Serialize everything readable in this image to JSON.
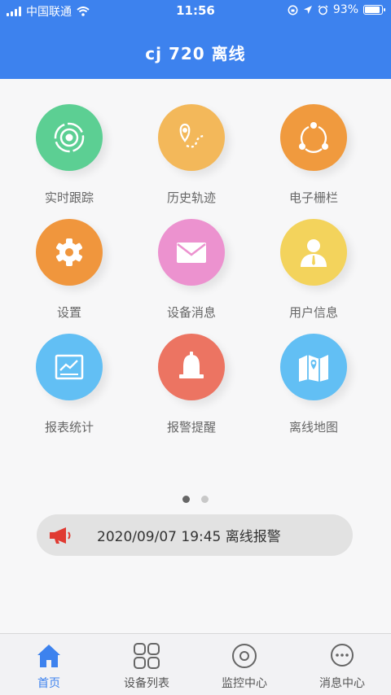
{
  "status_bar": {
    "carrier": "中国联通",
    "time": "11:56",
    "battery": "93%"
  },
  "header": {
    "title": "cj 720 离线"
  },
  "colors": {
    "primary": "#3d82ee"
  },
  "menu": [
    {
      "label": "实时跟踪",
      "icon": "target-icon",
      "color": "#5ccf93"
    },
    {
      "label": "历史轨迹",
      "icon": "route-pin-icon",
      "color": "#f3b85a"
    },
    {
      "label": "电子栅栏",
      "icon": "fence-nodes-icon",
      "color": "#f09a3e"
    },
    {
      "label": "设置",
      "icon": "gear-icon",
      "color": "#f0963d"
    },
    {
      "label": "设备消息",
      "icon": "envelope-icon",
      "color": "#ec92cf"
    },
    {
      "label": "用户信息",
      "icon": "user-icon",
      "color": "#f3d35c"
    },
    {
      "label": "报表统计",
      "icon": "report-chart-icon",
      "color": "#62bff4"
    },
    {
      "label": "报警提醒",
      "icon": "bell-icon",
      "color": "#ec7462"
    },
    {
      "label": "离线地图",
      "icon": "map-icon",
      "color": "#62bff4"
    }
  ],
  "notice": {
    "text": "2020/09/07 19:45 离线报警",
    "icon": "megaphone-icon"
  },
  "tabs": [
    {
      "label": "首页",
      "icon": "home-icon",
      "active": true
    },
    {
      "label": "设备列表",
      "icon": "grid-icon",
      "active": false
    },
    {
      "label": "监控中心",
      "icon": "monitor-icon",
      "active": false
    },
    {
      "label": "消息中心",
      "icon": "message-icon",
      "active": false
    }
  ]
}
